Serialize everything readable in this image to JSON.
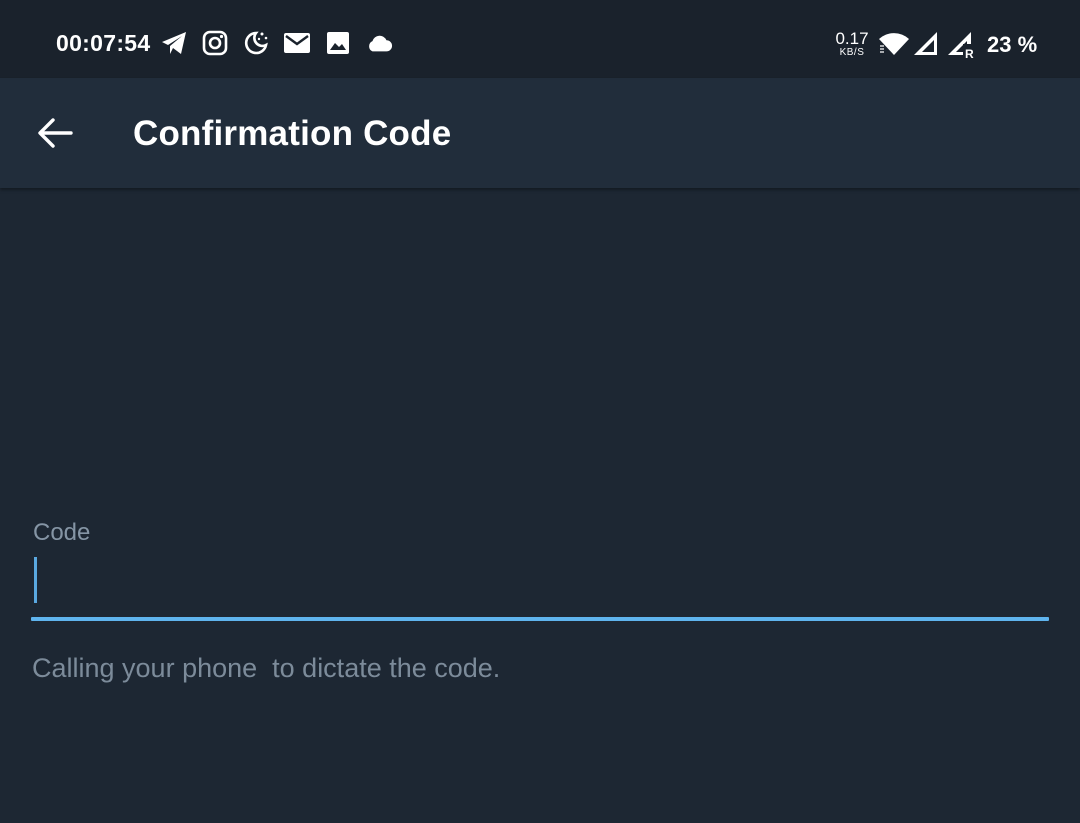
{
  "status_bar": {
    "time": "00:07:54",
    "left_icons": [
      "telegram-icon",
      "instagram-icon",
      "night-mode-icon",
      "mail-icon",
      "gallery-icon",
      "cloud-icon"
    ],
    "net_speed_value": "0.17",
    "net_speed_unit": "KB/S",
    "signal_roaming_label": "R",
    "battery": "23 %"
  },
  "app_bar": {
    "back_icon": "arrow-left-icon",
    "title": "Confirmation Code"
  },
  "form": {
    "code_label": "Code",
    "code_value": "",
    "hint": "Calling your phone  to dictate the code."
  },
  "colors": {
    "background": "#1d2733",
    "app_bar": "#212d3b",
    "accent": "#5fb4ee",
    "label": "#8595a5"
  }
}
